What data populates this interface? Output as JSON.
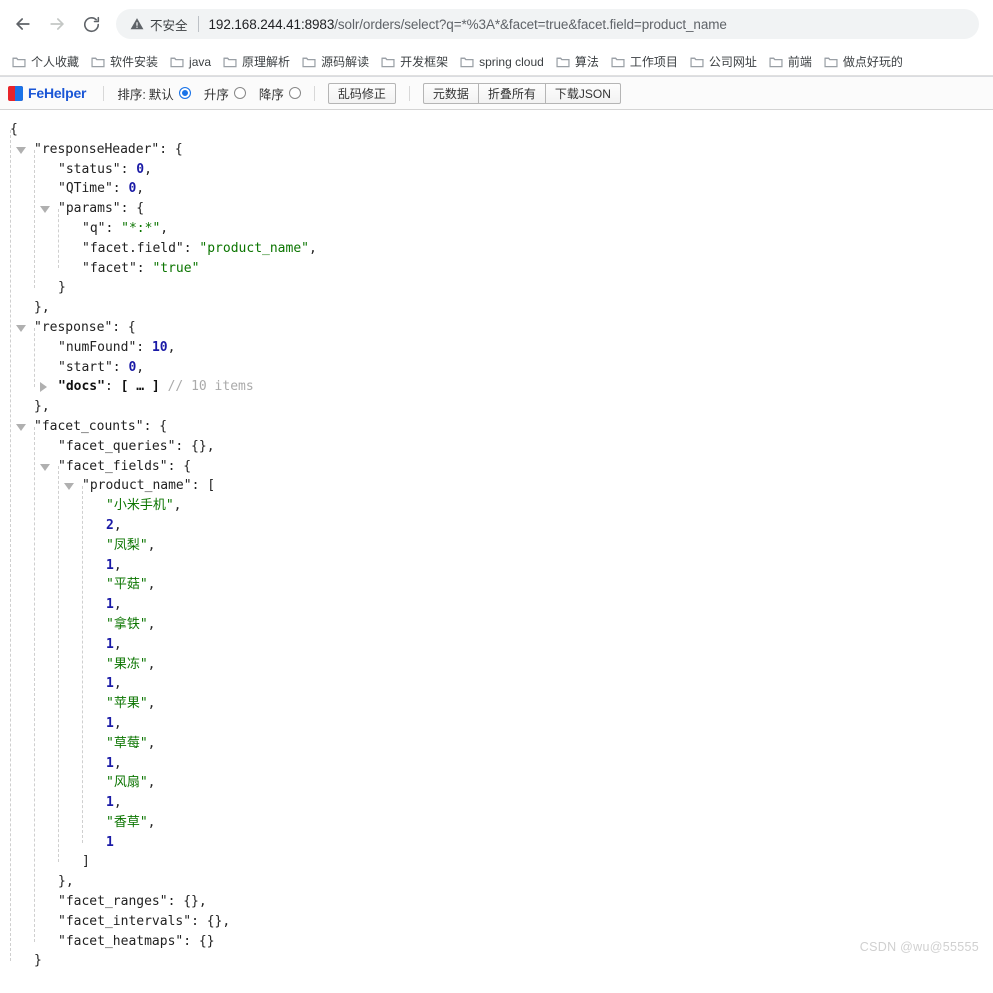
{
  "browser": {
    "nav": {
      "back_icon": "arrow-left-icon",
      "forward_icon": "arrow-right-icon",
      "reload_icon": "reload-icon"
    },
    "omnibox": {
      "security_icon": "warning-triangle-icon",
      "security_label": "不安全",
      "url_host": "192.168.244.41:8983",
      "url_path": "/solr/orders/select?q=*%3A*&facet=true&facet.field=product_name",
      "url_full": "192.168.244.41:8983/solr/orders/select?q=*%3A*&facet=true&facet.field=product_name"
    },
    "bookmarks": [
      {
        "label": "个人收藏",
        "icon": "folder-icon"
      },
      {
        "label": "软件安装",
        "icon": "folder-icon"
      },
      {
        "label": "java",
        "icon": "folder-icon"
      },
      {
        "label": "原理解析",
        "icon": "folder-icon"
      },
      {
        "label": "源码解读",
        "icon": "folder-icon"
      },
      {
        "label": "开发框架",
        "icon": "folder-icon"
      },
      {
        "label": "spring cloud",
        "icon": "folder-icon"
      },
      {
        "label": "算法",
        "icon": "folder-icon"
      },
      {
        "label": "工作项目",
        "icon": "folder-icon"
      },
      {
        "label": "公司网址",
        "icon": "folder-icon"
      },
      {
        "label": "前端",
        "icon": "folder-icon"
      },
      {
        "label": "做点好玩的",
        "icon": "folder-icon"
      }
    ]
  },
  "fehelper": {
    "brand": "FeHelper",
    "logo_icon": "fehelper-logo-icon",
    "sort_label": "排序:",
    "sort_options": [
      {
        "label": "默认",
        "selected": true
      },
      {
        "label": "升序",
        "selected": false
      },
      {
        "label": "降序",
        "selected": false
      }
    ],
    "fix_encoding_button": "乱码修正",
    "buttons": [
      "元数据",
      "折叠所有",
      "下载JSON"
    ]
  },
  "json": {
    "lines": [
      {
        "indent": 0,
        "tri": null,
        "segs": [
          {
            "t": "{",
            "c": "jpunc"
          }
        ]
      },
      {
        "indent": 1,
        "tri": "open",
        "segs": [
          {
            "t": "\"responseHeader\"",
            "c": "jkey"
          },
          {
            "t": ": {",
            "c": "jpunc"
          }
        ]
      },
      {
        "indent": 2,
        "tri": null,
        "segs": [
          {
            "t": "\"status\"",
            "c": "jkey"
          },
          {
            "t": ": ",
            "c": "jpunc"
          },
          {
            "t": "0",
            "c": "jnum"
          },
          {
            "t": ",",
            "c": "jpunc"
          }
        ]
      },
      {
        "indent": 2,
        "tri": null,
        "segs": [
          {
            "t": "\"QTime\"",
            "c": "jkey"
          },
          {
            "t": ": ",
            "c": "jpunc"
          },
          {
            "t": "0",
            "c": "jnum"
          },
          {
            "t": ",",
            "c": "jpunc"
          }
        ]
      },
      {
        "indent": 2,
        "tri": "open",
        "segs": [
          {
            "t": "\"params\"",
            "c": "jkey"
          },
          {
            "t": ": {",
            "c": "jpunc"
          }
        ]
      },
      {
        "indent": 3,
        "tri": null,
        "segs": [
          {
            "t": "\"q\"",
            "c": "jkey"
          },
          {
            "t": ": ",
            "c": "jpunc"
          },
          {
            "t": "\"*:*\"",
            "c": "jstr"
          },
          {
            "t": ",",
            "c": "jpunc"
          }
        ]
      },
      {
        "indent": 3,
        "tri": null,
        "segs": [
          {
            "t": "\"facet.field\"",
            "c": "jkey"
          },
          {
            "t": ": ",
            "c": "jpunc"
          },
          {
            "t": "\"product_name\"",
            "c": "jstr"
          },
          {
            "t": ",",
            "c": "jpunc"
          }
        ]
      },
      {
        "indent": 3,
        "tri": null,
        "segs": [
          {
            "t": "\"facet\"",
            "c": "jkey"
          },
          {
            "t": ": ",
            "c": "jpunc"
          },
          {
            "t": "\"true\"",
            "c": "jstr"
          }
        ]
      },
      {
        "indent": 2,
        "tri": null,
        "segs": [
          {
            "t": "}",
            "c": "jpunc"
          }
        ]
      },
      {
        "indent": 1,
        "tri": null,
        "segs": [
          {
            "t": "},",
            "c": "jpunc"
          }
        ]
      },
      {
        "indent": 1,
        "tri": "open",
        "segs": [
          {
            "t": "\"response\"",
            "c": "jkey"
          },
          {
            "t": ": {",
            "c": "jpunc"
          }
        ]
      },
      {
        "indent": 2,
        "tri": null,
        "segs": [
          {
            "t": "\"numFound\"",
            "c": "jkey"
          },
          {
            "t": ": ",
            "c": "jpunc"
          },
          {
            "t": "10",
            "c": "jnum"
          },
          {
            "t": ",",
            "c": "jpunc"
          }
        ]
      },
      {
        "indent": 2,
        "tri": null,
        "segs": [
          {
            "t": "\"start\"",
            "c": "jkey"
          },
          {
            "t": ": ",
            "c": "jpunc"
          },
          {
            "t": "0",
            "c": "jnum"
          },
          {
            "t": ",",
            "c": "jpunc"
          }
        ]
      },
      {
        "indent": 2,
        "tri": "closed",
        "segs": [
          {
            "t": "\"docs\"",
            "c": "jkey-b"
          },
          {
            "t": ": ",
            "c": "jpunc"
          },
          {
            "t": "[ … ]",
            "c": "jkey-b"
          },
          {
            "t": " // 10 items",
            "c": "jcomment"
          }
        ]
      },
      {
        "indent": 1,
        "tri": null,
        "segs": [
          {
            "t": "},",
            "c": "jpunc"
          }
        ]
      },
      {
        "indent": 1,
        "tri": "open",
        "segs": [
          {
            "t": "\"facet_counts\"",
            "c": "jkey"
          },
          {
            "t": ": {",
            "c": "jpunc"
          }
        ]
      },
      {
        "indent": 2,
        "tri": null,
        "segs": [
          {
            "t": "\"facet_queries\"",
            "c": "jkey"
          },
          {
            "t": ": {},",
            "c": "jpunc"
          }
        ]
      },
      {
        "indent": 2,
        "tri": "open",
        "segs": [
          {
            "t": "\"facet_fields\"",
            "c": "jkey"
          },
          {
            "t": ": {",
            "c": "jpunc"
          }
        ]
      },
      {
        "indent": 3,
        "tri": "open",
        "segs": [
          {
            "t": "\"product_name\"",
            "c": "jkey"
          },
          {
            "t": ": [",
            "c": "jpunc"
          }
        ]
      },
      {
        "indent": 4,
        "tri": null,
        "segs": [
          {
            "t": "\"小米手机\"",
            "c": "jstr"
          },
          {
            "t": ",",
            "c": "jpunc"
          }
        ]
      },
      {
        "indent": 4,
        "tri": null,
        "segs": [
          {
            "t": "2",
            "c": "jnum"
          },
          {
            "t": ",",
            "c": "jpunc"
          }
        ]
      },
      {
        "indent": 4,
        "tri": null,
        "segs": [
          {
            "t": "\"凤梨\"",
            "c": "jstr"
          },
          {
            "t": ",",
            "c": "jpunc"
          }
        ]
      },
      {
        "indent": 4,
        "tri": null,
        "segs": [
          {
            "t": "1",
            "c": "jnum"
          },
          {
            "t": ",",
            "c": "jpunc"
          }
        ]
      },
      {
        "indent": 4,
        "tri": null,
        "segs": [
          {
            "t": "\"平菇\"",
            "c": "jstr"
          },
          {
            "t": ",",
            "c": "jpunc"
          }
        ]
      },
      {
        "indent": 4,
        "tri": null,
        "segs": [
          {
            "t": "1",
            "c": "jnum"
          },
          {
            "t": ",",
            "c": "jpunc"
          }
        ]
      },
      {
        "indent": 4,
        "tri": null,
        "segs": [
          {
            "t": "\"拿铁\"",
            "c": "jstr"
          },
          {
            "t": ",",
            "c": "jpunc"
          }
        ]
      },
      {
        "indent": 4,
        "tri": null,
        "segs": [
          {
            "t": "1",
            "c": "jnum"
          },
          {
            "t": ",",
            "c": "jpunc"
          }
        ]
      },
      {
        "indent": 4,
        "tri": null,
        "segs": [
          {
            "t": "\"果冻\"",
            "c": "jstr"
          },
          {
            "t": ",",
            "c": "jpunc"
          }
        ]
      },
      {
        "indent": 4,
        "tri": null,
        "segs": [
          {
            "t": "1",
            "c": "jnum"
          },
          {
            "t": ",",
            "c": "jpunc"
          }
        ]
      },
      {
        "indent": 4,
        "tri": null,
        "segs": [
          {
            "t": "\"苹果\"",
            "c": "jstr"
          },
          {
            "t": ",",
            "c": "jpunc"
          }
        ]
      },
      {
        "indent": 4,
        "tri": null,
        "segs": [
          {
            "t": "1",
            "c": "jnum"
          },
          {
            "t": ",",
            "c": "jpunc"
          }
        ]
      },
      {
        "indent": 4,
        "tri": null,
        "segs": [
          {
            "t": "\"草莓\"",
            "c": "jstr"
          },
          {
            "t": ",",
            "c": "jpunc"
          }
        ]
      },
      {
        "indent": 4,
        "tri": null,
        "segs": [
          {
            "t": "1",
            "c": "jnum"
          },
          {
            "t": ",",
            "c": "jpunc"
          }
        ]
      },
      {
        "indent": 4,
        "tri": null,
        "segs": [
          {
            "t": "\"风扇\"",
            "c": "jstr"
          },
          {
            "t": ",",
            "c": "jpunc"
          }
        ]
      },
      {
        "indent": 4,
        "tri": null,
        "segs": [
          {
            "t": "1",
            "c": "jnum"
          },
          {
            "t": ",",
            "c": "jpunc"
          }
        ]
      },
      {
        "indent": 4,
        "tri": null,
        "segs": [
          {
            "t": "\"香草\"",
            "c": "jstr"
          },
          {
            "t": ",",
            "c": "jpunc"
          }
        ]
      },
      {
        "indent": 4,
        "tri": null,
        "segs": [
          {
            "t": "1",
            "c": "jnum"
          }
        ]
      },
      {
        "indent": 3,
        "tri": null,
        "segs": [
          {
            "t": "]",
            "c": "jpunc"
          }
        ]
      },
      {
        "indent": 2,
        "tri": null,
        "segs": [
          {
            "t": "},",
            "c": "jpunc"
          }
        ]
      },
      {
        "indent": 2,
        "tri": null,
        "segs": [
          {
            "t": "\"facet_ranges\"",
            "c": "jkey"
          },
          {
            "t": ": {},",
            "c": "jpunc"
          }
        ]
      },
      {
        "indent": 2,
        "tri": null,
        "segs": [
          {
            "t": "\"facet_intervals\"",
            "c": "jkey"
          },
          {
            "t": ": {},",
            "c": "jpunc"
          }
        ]
      },
      {
        "indent": 2,
        "tri": null,
        "segs": [
          {
            "t": "\"facet_heatmaps\"",
            "c": "jkey"
          },
          {
            "t": ": {}",
            "c": "jpunc"
          }
        ]
      },
      {
        "indent": 1,
        "tri": null,
        "segs": [
          {
            "t": "}",
            "c": "jpunc"
          }
        ]
      },
      {
        "indent": 0,
        "tri": null,
        "segs": [
          {
            "t": "}",
            "c": "jpunc"
          }
        ]
      }
    ],
    "guides": [
      {
        "indent": 1,
        "from": 1,
        "to": 42
      },
      {
        "indent": 2,
        "from": 2,
        "to": 8
      },
      {
        "indent": 3,
        "from": 5,
        "to": 7
      },
      {
        "indent": 2,
        "from": 11,
        "to": 13
      },
      {
        "indent": 2,
        "from": 16,
        "to": 41
      },
      {
        "indent": 3,
        "from": 18,
        "to": 37
      },
      {
        "indent": 4,
        "from": 19,
        "to": 36
      }
    ]
  },
  "watermark": "CSDN @wu@55555"
}
